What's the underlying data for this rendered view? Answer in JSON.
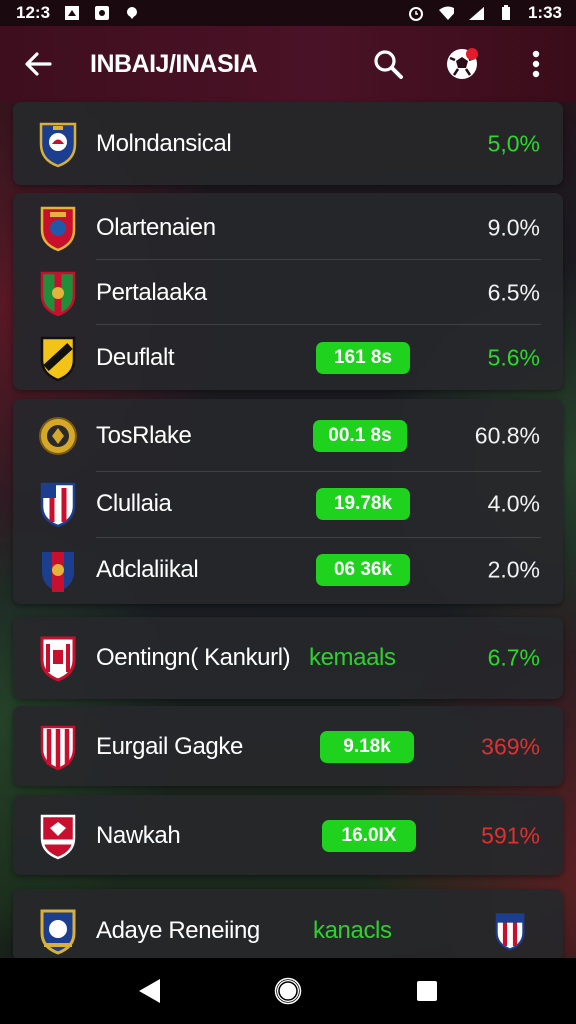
{
  "status_bar": {
    "time_left": "12:3",
    "time_right": "1:33"
  },
  "app_bar": {
    "title": "INBAIJ/INASIA"
  },
  "colors": {
    "accent_green": "#1ed21e",
    "negative_red": "#e03030",
    "app_bar": "#4a1226"
  },
  "icons": {
    "back": "arrow-left-icon",
    "search": "search-icon",
    "notifications": "soccer-ball-icon",
    "more": "more-vert-icon"
  },
  "cards": [
    {
      "rows": [
        {
          "name": "Molndansical",
          "pct": "5,0%",
          "pct_color": "green"
        }
      ]
    },
    {
      "rows": [
        {
          "name": "Olartenaien",
          "pct": "9.0%",
          "pct_color": "white"
        },
        {
          "name": "Pertalaaka",
          "pct": "6.5%",
          "pct_color": "white"
        },
        {
          "name": "Deuflalt",
          "badge": "161 8s",
          "pct": "5.6%",
          "pct_color": "green"
        }
      ]
    },
    {
      "rows": [
        {
          "name": "TosRlake",
          "badge": "00.1 8s",
          "pct": "60.8%",
          "pct_color": "white"
        },
        {
          "name": "Clullaia",
          "badge": "19.78k",
          "pct": "4.0%",
          "pct_color": "white"
        },
        {
          "name": "Adclaliikal",
          "badge": "06 36k",
          "pct": "2.0%",
          "pct_color": "white"
        }
      ]
    },
    {
      "rows": [
        {
          "name": "Oentingn( Kankurl)",
          "tag": "kemaals",
          "pct": "6.7%",
          "pct_color": "green"
        }
      ]
    },
    {
      "rows": [
        {
          "name": "Eurgail Gagke",
          "badge": "9.18k",
          "pct": "369%",
          "pct_color": "red"
        }
      ]
    },
    {
      "rows": [
        {
          "name": "Nawkah",
          "badge": "16.0IX",
          "pct": "591%",
          "pct_color": "red"
        }
      ]
    },
    {
      "rows": [
        {
          "name": "Adaye Reneiing",
          "tag": "kanacls"
        }
      ]
    }
  ]
}
